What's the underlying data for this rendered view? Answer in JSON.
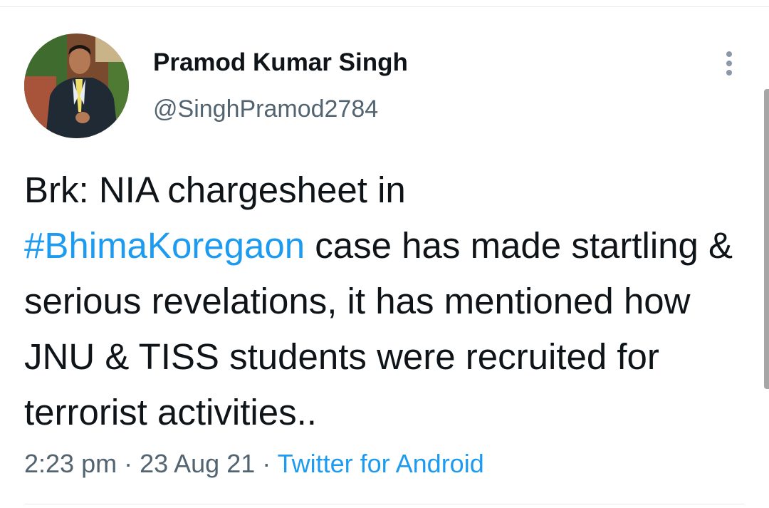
{
  "tweet": {
    "author": {
      "display_name": "Pramod Kumar Singh",
      "handle": "@SinghPramod2784",
      "avatar_icon": "profile-photo"
    },
    "more_icon": "more-options-icon",
    "text": {
      "part1": "Brk: NIA chargesheet in",
      "hashtag": "#BhimaKoregaon",
      "part2": " case has made startling & serious revelations, it has mentioned how JNU & TISS students were recruited for terrorist activities.."
    },
    "meta": {
      "time": "2:23 pm",
      "separator": " · ",
      "date": "23 Aug 21",
      "source": "Twitter for Android"
    }
  },
  "colors": {
    "link": "#1d9bf0",
    "secondary_text": "#536471",
    "primary_text": "#0f1419",
    "divider": "#e7e9ea"
  }
}
